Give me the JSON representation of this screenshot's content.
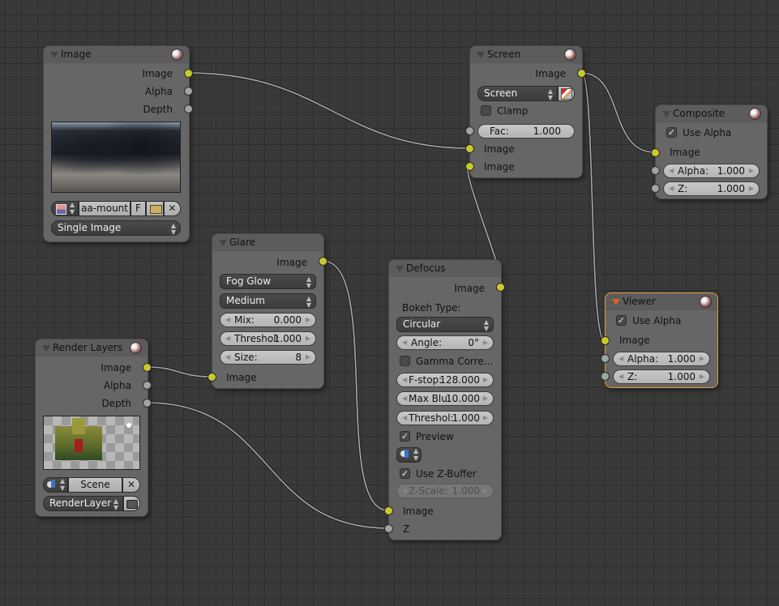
{
  "editor": "Node Editor (Compositing)",
  "colors": {
    "background": "#393939",
    "grid_line": "#2e2e2e",
    "node_body": "#666666",
    "node_header": "#5c5c5c",
    "image_socket": "#c9c92c",
    "value_socket": "#a3a3a3",
    "active_node_border": "#e89a3c",
    "wire": "#a8a8a8"
  },
  "nodes": {
    "image": {
      "title": "Image",
      "outputs": [
        "Image",
        "Alpha",
        "Depth"
      ],
      "preview_icon": "image-preview-snowy-landscape",
      "image_type_icon": "image-datablock-icon",
      "image_name": "aa-mount",
      "fake_user_label": "F",
      "open_icon": "folder-open-icon",
      "unlink_icon": "x-icon",
      "source": "Single Image"
    },
    "screen": {
      "title": "Screen",
      "outputs": [
        "Image"
      ],
      "blend_mode": "Screen",
      "alpha_icon": "alpha-checker-icon",
      "clamp_label": "Clamp",
      "clamp_checked": false,
      "fac_label": "Fac:",
      "fac_value": "1.000",
      "inputs": [
        "Image",
        "Image"
      ]
    },
    "composite": {
      "title": "Composite",
      "use_alpha_label": "Use Alpha",
      "use_alpha_checked": true,
      "inputs": [
        "Image"
      ],
      "alpha_label": "Alpha:",
      "alpha_value": "1.000",
      "z_label": "Z:",
      "z_value": "1.000"
    },
    "glare": {
      "title": "Glare",
      "outputs": [
        "Image"
      ],
      "glare_type": "Fog Glow",
      "quality": "Medium",
      "mix_label": "Mix:",
      "mix_value": "0.000",
      "threshold_label": "Threshol:",
      "threshold_value": "1.000",
      "size_label": "Size:",
      "size_value": "8",
      "inputs": [
        "Image"
      ]
    },
    "defocus": {
      "title": "Defocus",
      "outputs": [
        "Image"
      ],
      "bokeh_type_label": "Bokeh Type:",
      "bokeh_type": "Circular",
      "angle_label": "Angle:",
      "angle_value": "0°",
      "gamma_label": "Gamma Corre...",
      "gamma_checked": false,
      "fstop_label": "F-stop:",
      "fstop_value": "128.000",
      "maxblur_label": "Max Blu:",
      "maxblur_value": "10.000",
      "threshold_label": "Threshol:",
      "threshold_value": "1.000",
      "preview_label": "Preview",
      "preview_checked": true,
      "scene_icon": "scene-icon",
      "zbuffer_label": "Use Z-Buffer",
      "zbuffer_checked": true,
      "zscale_label": "Z-Scale:",
      "zscale_value": "1.000",
      "inputs": [
        "Image",
        "Z"
      ]
    },
    "viewer": {
      "title": "Viewer",
      "active": true,
      "use_alpha_label": "Use Alpha",
      "use_alpha_checked": true,
      "inputs": [
        "Image"
      ],
      "alpha_label": "Alpha:",
      "alpha_value": "1.000",
      "z_label": "Z:",
      "z_value": "1.000"
    },
    "render_layers": {
      "title": "Render Layers",
      "outputs": [
        "Image",
        "Alpha",
        "Depth"
      ],
      "preview_icon": "render-preview-castle",
      "scene_icon": "scene-icon",
      "scene_name": "Scene",
      "unlink_icon": "x-icon",
      "layer": "RenderLayer",
      "render_icon": "render-camera-icon"
    }
  },
  "links": [
    {
      "from": "Image.Image",
      "to": "Screen.Image(1)"
    },
    {
      "from": "Screen.Image",
      "to": "Composite.Image"
    },
    {
      "from": "Screen.Image",
      "to": "Viewer.Image"
    },
    {
      "from": "Defocus.Image",
      "to": "Screen.Image(2)"
    },
    {
      "from": "Glare.Image",
      "to": "Defocus.Image"
    },
    {
      "from": "Render Layers.Image",
      "to": "Glare.Image"
    },
    {
      "from": "Render Layers.Depth",
      "to": "Defocus.Z"
    }
  ]
}
